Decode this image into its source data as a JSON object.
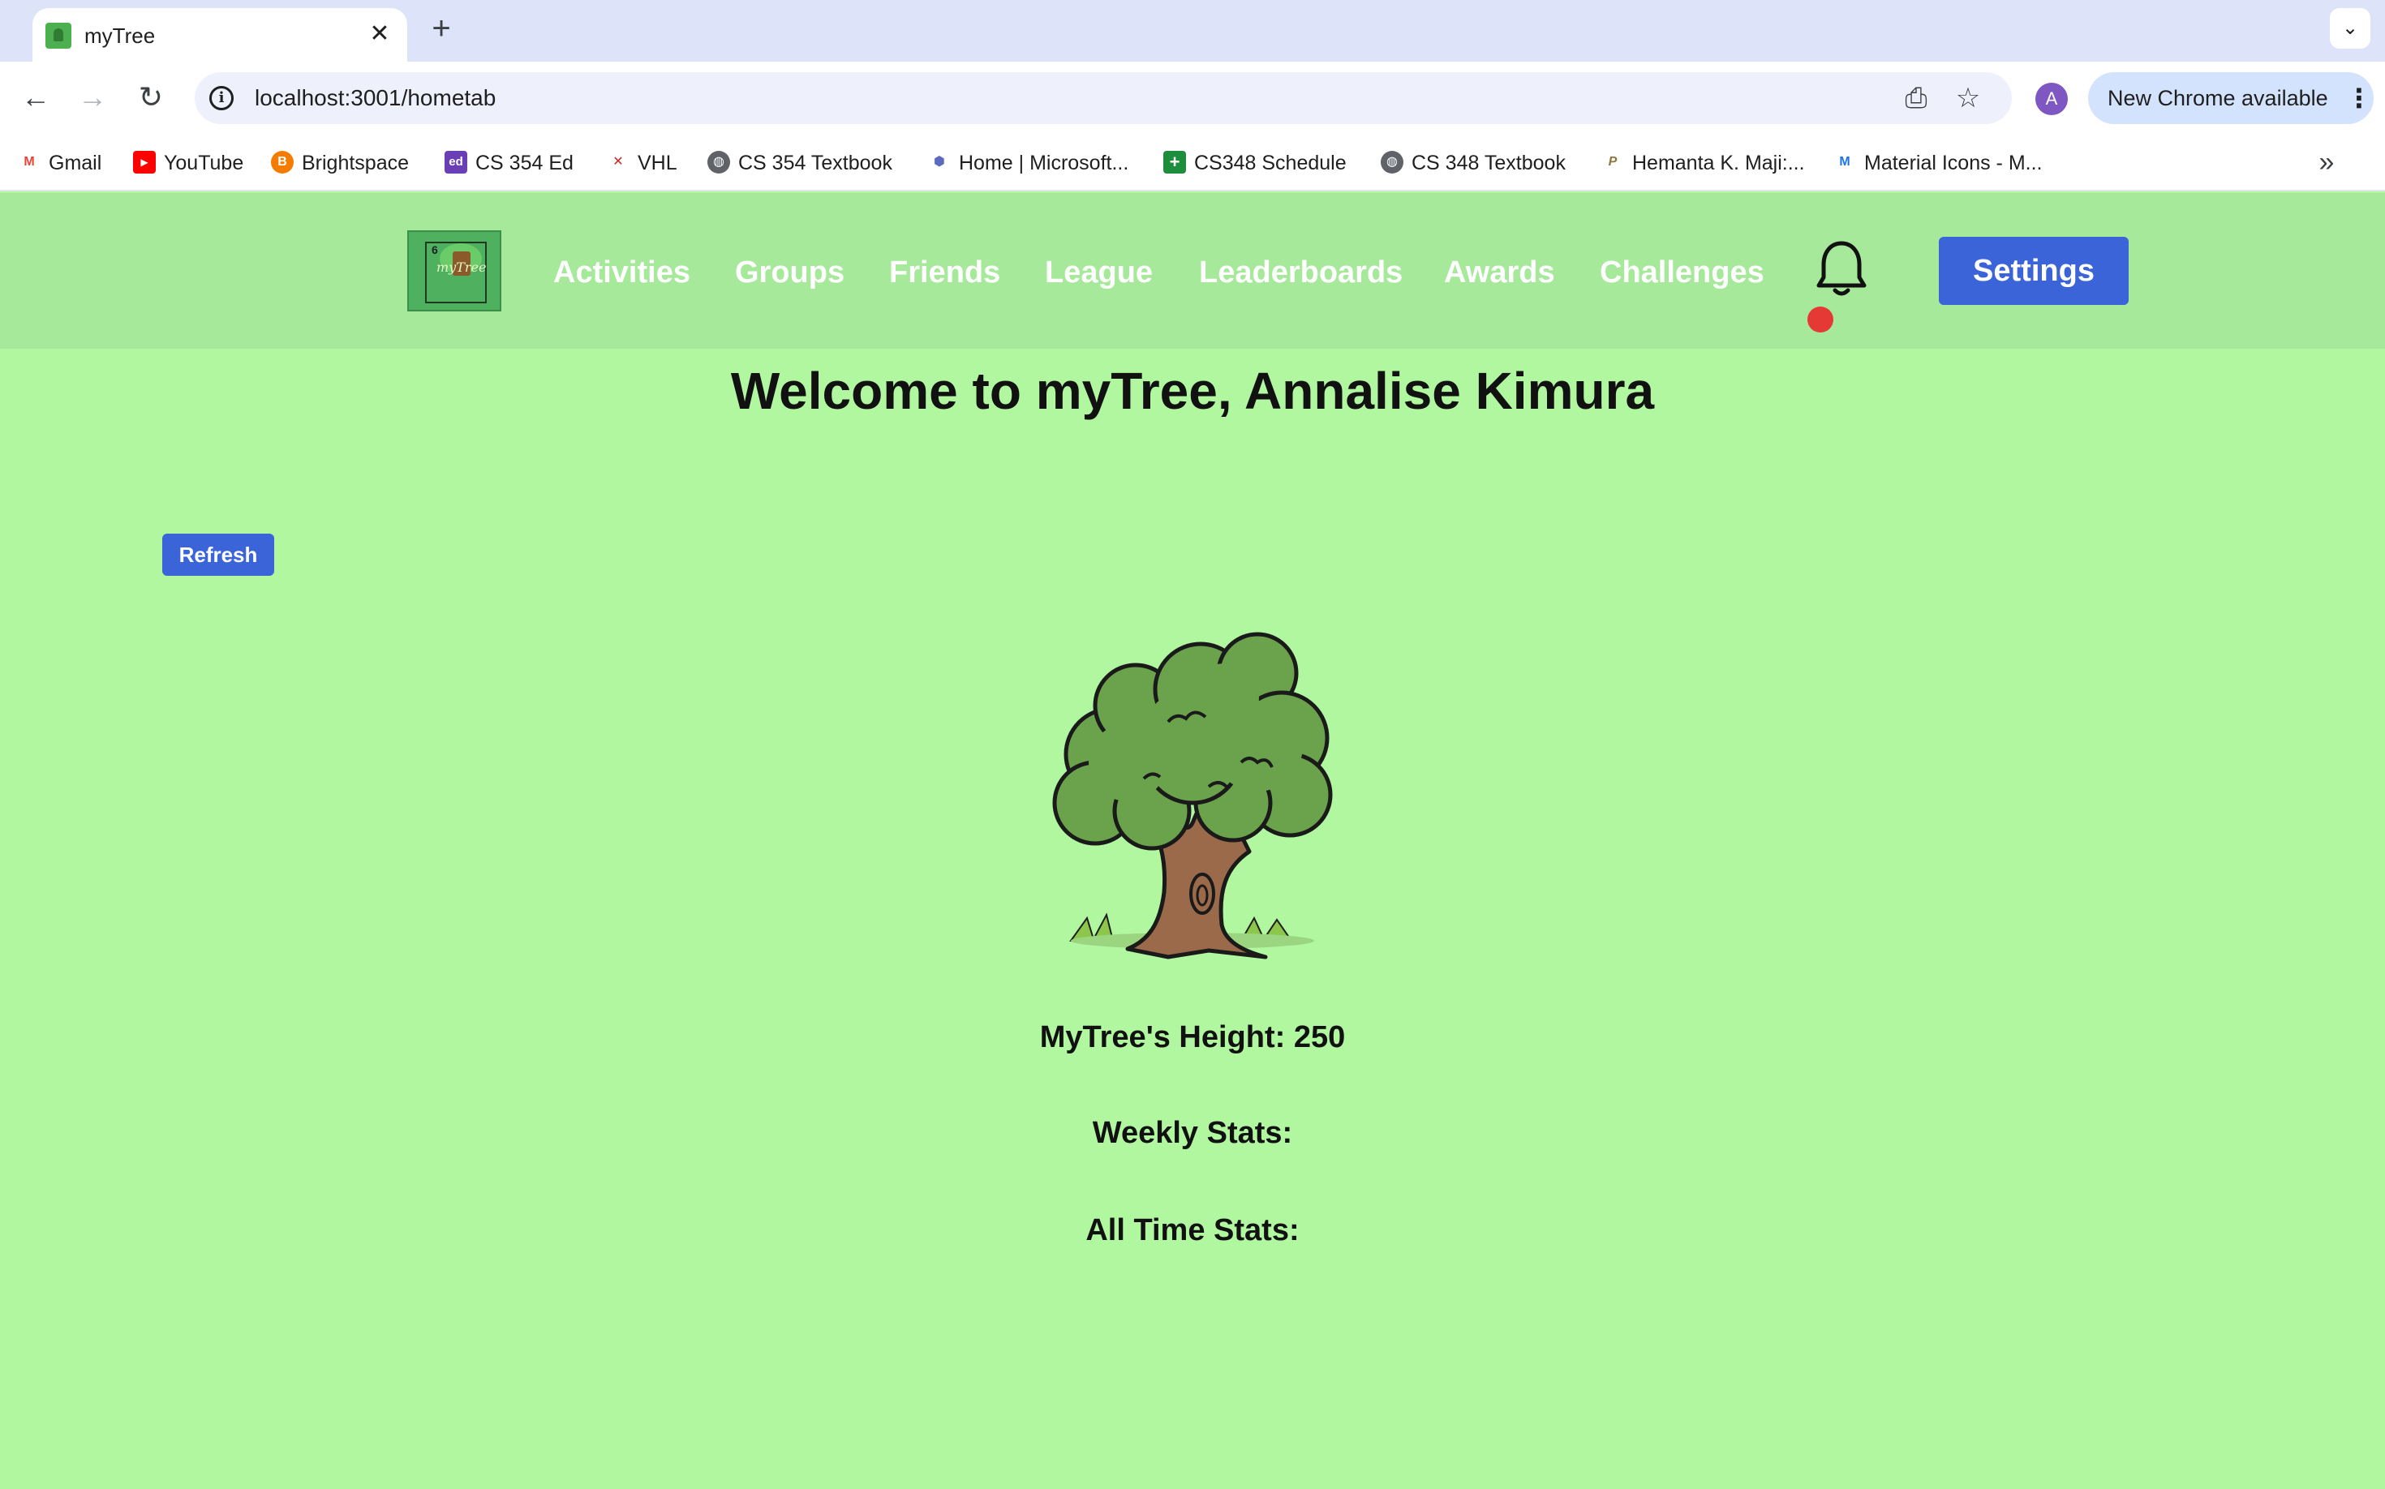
{
  "browser": {
    "tab_title": "myTree",
    "url": "localhost:3001/hometab",
    "profile_initial": "A",
    "update_label": "New Chrome available"
  },
  "bookmarks": [
    {
      "label": "Gmail",
      "icon": "gmail-icon",
      "color": "#ea4335",
      "glyph": "M"
    },
    {
      "label": "YouTube",
      "icon": "youtube-icon",
      "color": "#ff0000",
      "glyph": "▶"
    },
    {
      "label": "Brightspace",
      "icon": "brightspace-icon",
      "color": "#f57c00",
      "glyph": "B"
    },
    {
      "label": "CS 354 Ed",
      "icon": "ed-icon",
      "color": "#6a3fb5",
      "glyph": "ed"
    },
    {
      "label": "VHL",
      "icon": "vhl-icon",
      "color": "#c62828",
      "glyph": "✕"
    },
    {
      "label": "CS 354 Textbook",
      "icon": "globe-icon",
      "color": "#5f6368",
      "glyph": "◍"
    },
    {
      "label": "Home | Microsoft...",
      "icon": "microsoft-icon",
      "color": "#5c6bc0",
      "glyph": "⬢"
    },
    {
      "label": "CS348 Schedule",
      "icon": "sheets-icon",
      "color": "#1e8e3e",
      "glyph": "+"
    },
    {
      "label": "CS 348 Textbook",
      "icon": "globe-icon",
      "color": "#5f6368",
      "glyph": "◍"
    },
    {
      "label": "Hemanta K. Maji:...",
      "icon": "purdue-icon",
      "color": "#8d7741",
      "glyph": "P"
    },
    {
      "label": "Material Icons - M...",
      "icon": "material-icon",
      "color": "#1a73e8",
      "glyph": "M"
    }
  ],
  "app": {
    "nav": [
      "Activities",
      "Groups",
      "Friends",
      "League",
      "Leaderboards",
      "Awards",
      "Challenges"
    ],
    "settings_label": "Settings",
    "logo_badge": "6",
    "logo_text": "myTree",
    "welcome_title": "Welcome to myTree, Annalise Kimura",
    "refresh_label": "Refresh",
    "height_text": "MyTree's Height: 250",
    "weekly_stats_label": "Weekly Stats:",
    "all_time_stats_label": "All Time Stats:"
  },
  "colors": {
    "page_background": "#b0f7a0",
    "header_background": "#a7e99a",
    "button_blue": "#3a64d8",
    "notification_dot": "#e53935"
  }
}
